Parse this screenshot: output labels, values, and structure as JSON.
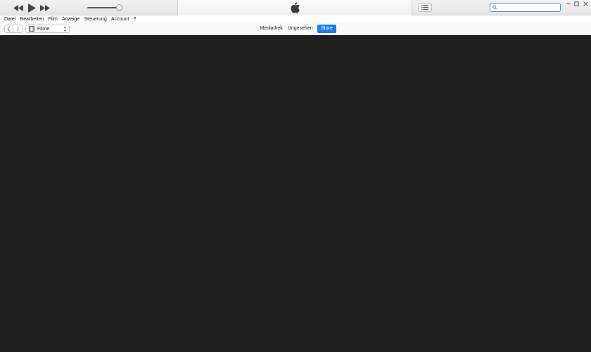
{
  "colors": {
    "content_bg": "#202020",
    "accent": "#1f7ce8",
    "search_border": "#4f8fe0"
  },
  "player": {
    "rewind_icon": "rewind-icon",
    "play_icon": "play-icon",
    "fast_forward_icon": "fast-forward-icon",
    "volume_level": 0.92
  },
  "lcd": {
    "icon": "apple-logo-icon"
  },
  "toolbar": {
    "list_view_icon": "list-icon"
  },
  "search": {
    "placeholder": "",
    "value": "",
    "icon": "search-icon"
  },
  "window_controls": [
    "minimize-icon",
    "maximize-icon",
    "close-icon"
  ],
  "menu": {
    "items": [
      "Datei",
      "Bearbeiten",
      "Film",
      "Anzeige",
      "Steuerung",
      "Account",
      "?"
    ]
  },
  "nav": {
    "back_icon": "chevron-left-icon",
    "forward_icon": "chevron-right-icon",
    "media_type": "Filme",
    "media_icon": "film-icon"
  },
  "tabs": [
    {
      "label": "Mediathek",
      "active": false
    },
    {
      "label": "Ungesehen",
      "active": false
    },
    {
      "label": "Store",
      "active": true
    }
  ]
}
